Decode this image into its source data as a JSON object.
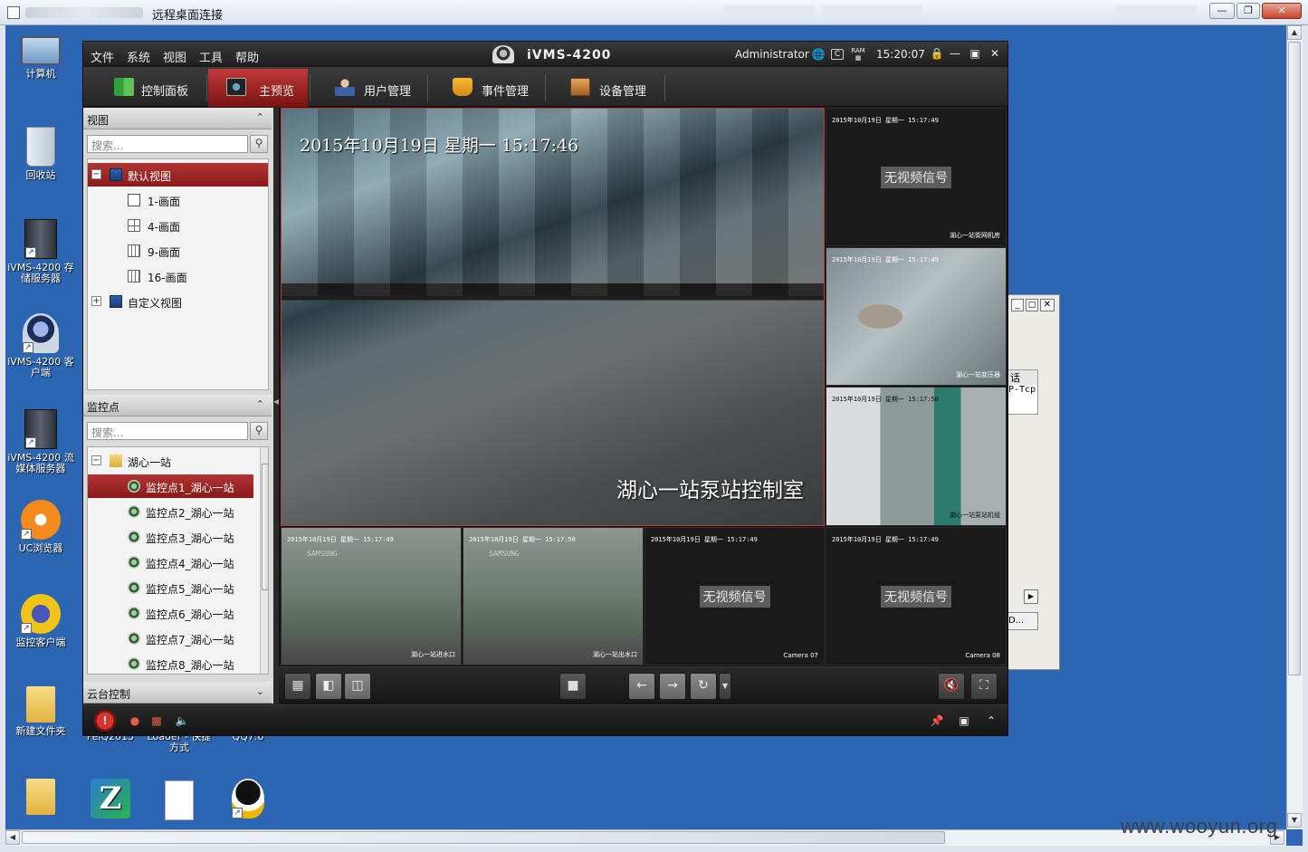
{
  "remote_desktop": {
    "title": "远程桌面连接"
  },
  "watermark": "www.wooyun.org",
  "desktop_icons": [
    {
      "label": "计算机",
      "icon": "computer-icon"
    },
    {
      "label": "回收站",
      "icon": "recycle-bin-icon"
    },
    {
      "label": "iVMS-4200 存储服务器",
      "icon": "storage-server-icon"
    },
    {
      "label": "iVMS-4200 客户端",
      "icon": "camera-client-icon"
    },
    {
      "label": "iVMS-4200 流媒体服务器",
      "icon": "stream-server-icon"
    },
    {
      "label": "UC浏览器",
      "icon": "uc-browser-icon"
    },
    {
      "label": "监控客户端",
      "icon": "monitor-client-icon"
    },
    {
      "label": "新建文件夹",
      "icon": "folder-icon"
    },
    {
      "label": "FeiQ2013",
      "icon": "feiq-icon"
    },
    {
      "label": "Loader - 快捷方式",
      "icon": "loader-icon"
    },
    {
      "label": "QQ7.6",
      "icon": "qq-icon"
    }
  ],
  "ivms": {
    "menu": [
      "文件",
      "系统",
      "视图",
      "工具",
      "帮助"
    ],
    "title": "iVMS-4200",
    "user": "Administrator",
    "time": "15:20:07",
    "tabs": [
      "控制面板",
      "主预览",
      "用户管理",
      "事件管理",
      "设备管理"
    ],
    "view_panel": {
      "header": "视图",
      "search_placeholder": "搜索...",
      "items": [
        "默认视图",
        "1-画面",
        "4-画面",
        "9-画面",
        "16-画面",
        "自定义视图"
      ]
    },
    "camera_panel": {
      "header": "监控点",
      "search_placeholder": "搜索...",
      "group": "湖心一站",
      "items": [
        "监控点1_湖心一站",
        "监控点2_湖心一站",
        "监控点3_湖心一站",
        "监控点4_湖心一站",
        "监控点5_湖心一站",
        "监控点6_湖心一站",
        "监控点7_湖心一站",
        "监控点8_湖心一站"
      ]
    },
    "ptz_header": "云台控制",
    "main_feed": {
      "timestamp": "2015年10月19日 星期一 15:17:46",
      "name": "湖心一站泵站控制室"
    },
    "feeds": [
      {
        "timestamp": "2015年10月19日 星期一 15:17:49",
        "status": "无视频信号",
        "name": "湖心一站街网机房"
      },
      {
        "timestamp": "2015年10月19日 星期一 15:17:49",
        "status": "",
        "name": "湖心一站变压器"
      },
      {
        "timestamp": "2015年10月19日 星期一 15:17:50",
        "status": "",
        "name": "湖心一站泵站机组"
      },
      {
        "timestamp": "2015年10月19日 星期一 15:17:49",
        "status": "",
        "name": "湖心一站进水口"
      },
      {
        "timestamp": "2015年10月19日 星期一 15:17:50",
        "status": "",
        "name": "湖心一站出水口"
      },
      {
        "timestamp": "2015年10月19日 星期一 15:17:49",
        "status": "无视频信号",
        "name": "Camera 07"
      },
      {
        "timestamp": "2015年10月19日 星期一 15:17:49",
        "status": "无视频信号",
        "name": "Camera 08"
      }
    ],
    "osd_brand": "SAMSUNG"
  },
  "background_window": {
    "text1": "话",
    "text2": "P-Tcp",
    "text3": "D..."
  }
}
